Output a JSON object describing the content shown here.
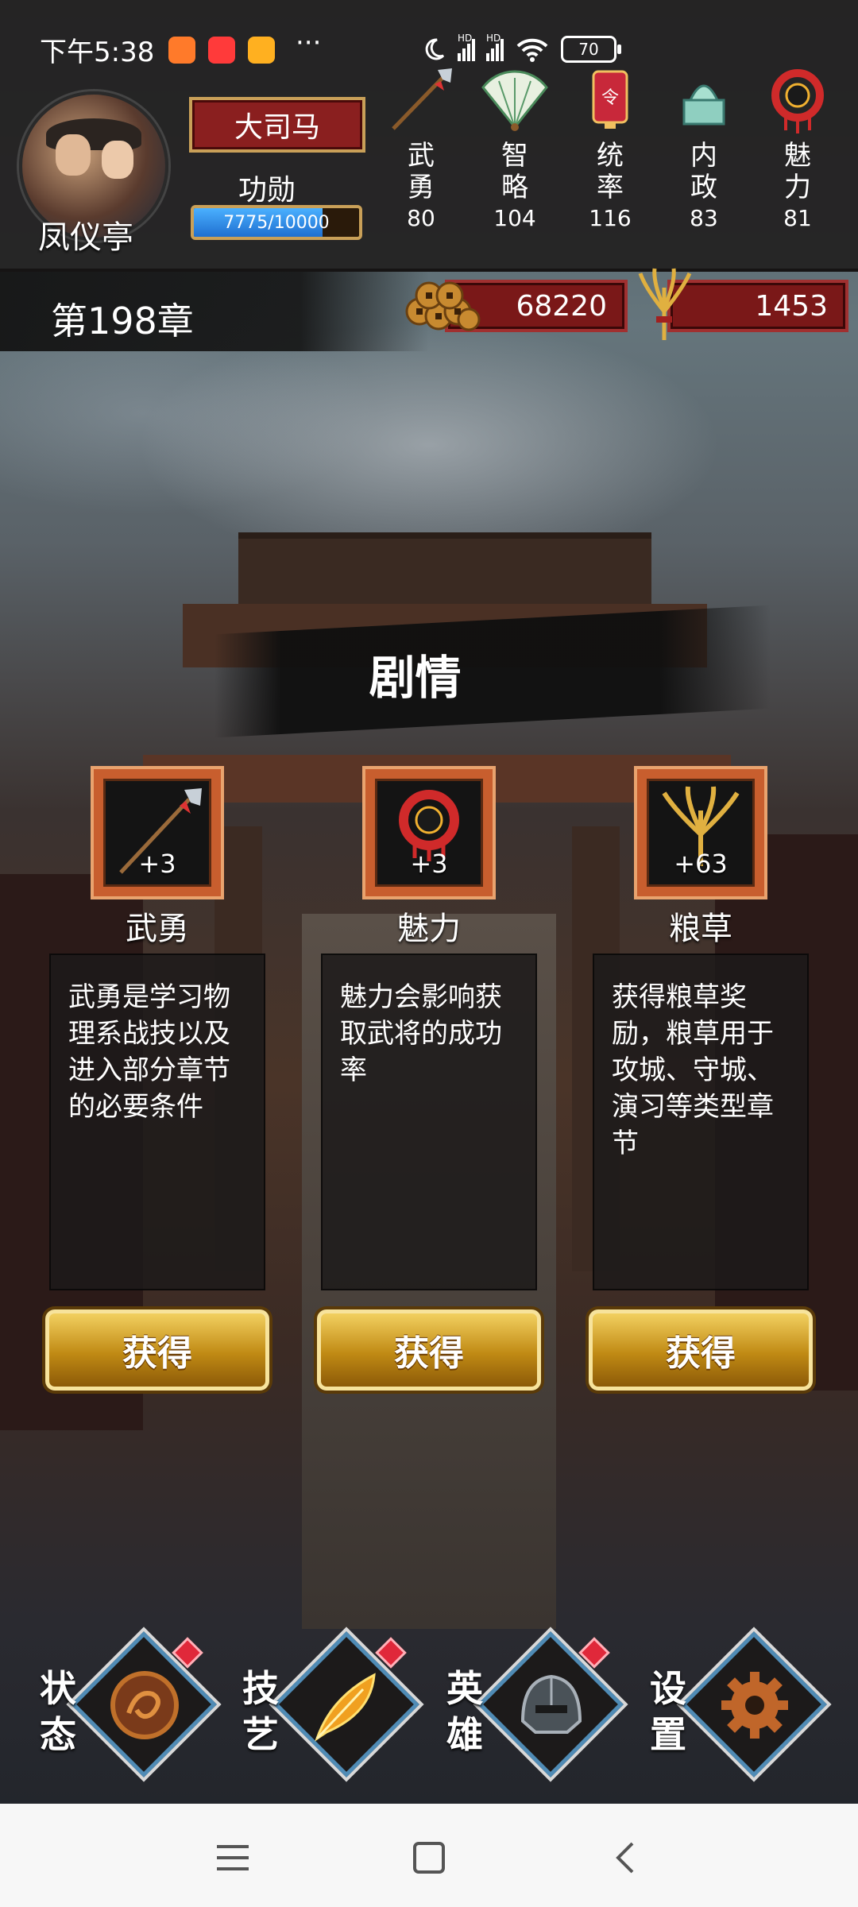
{
  "status_bar": {
    "time": "下午5:38",
    "more": "···",
    "battery": "70",
    "hd1": "HD",
    "hd2": "HD"
  },
  "player": {
    "name": "凤仪亭",
    "rank": "大司马",
    "merit_label": "功勋",
    "merit_text": "7775/10000",
    "merit_current": 7775,
    "merit_max": 10000
  },
  "stats": [
    {
      "label": "武勇",
      "value": "80",
      "icon": "halberd-icon"
    },
    {
      "label": "智略",
      "value": "104",
      "icon": "fan-icon"
    },
    {
      "label": "统率",
      "value": "116",
      "icon": "command-token-icon"
    },
    {
      "label": "内政",
      "value": "83",
      "icon": "jade-seal-icon"
    },
    {
      "label": "魅力",
      "value": "81",
      "icon": "charm-ornament-icon"
    }
  ],
  "chapter": "第198章",
  "resources": {
    "coins": "68220",
    "grain": "1453"
  },
  "plot_title": "剧情",
  "rewards": [
    {
      "bonus": "+3",
      "label": "武勇",
      "desc": "武勇是学习物理系战技以及进入部分章节的必要条件",
      "button": "获得",
      "icon": "halberd-icon"
    },
    {
      "bonus": "+3",
      "label": "魅力",
      "desc": "魅力会影响获取武将的成功率",
      "button": "获得",
      "icon": "charm-ornament-icon"
    },
    {
      "bonus": "+63",
      "label": "粮草",
      "desc": "获得粮草奖励，粮草用于攻城、守城、演习等类型章节",
      "button": "获得",
      "icon": "grain-icon"
    }
  ],
  "nav": [
    {
      "label": "状态",
      "icon": "dragon-medallion-icon",
      "badge": true
    },
    {
      "label": "技艺",
      "icon": "golden-feather-icon",
      "badge": true
    },
    {
      "label": "英雄",
      "icon": "helmet-icon",
      "badge": true
    },
    {
      "label": "设置",
      "icon": "gear-icon",
      "badge": false
    }
  ],
  "colors": {
    "accent_red": "#8a1f1f",
    "gold": "#c9a058",
    "card_orange": "#c85e2e",
    "nav_border": "#4f8bb5",
    "badge_red": "#e0283a"
  }
}
